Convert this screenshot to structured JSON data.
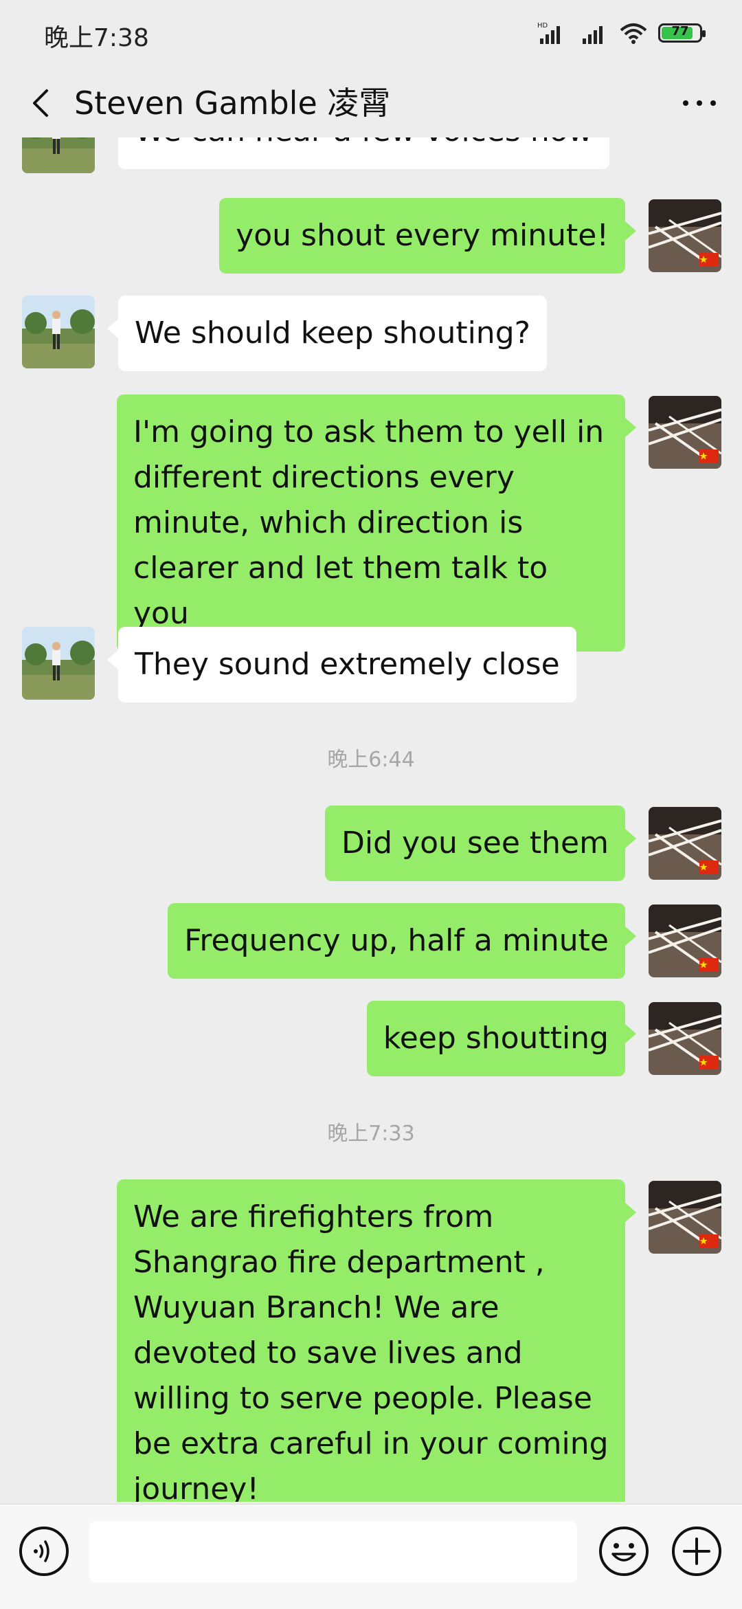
{
  "status_bar": {
    "time": "晚上7:38",
    "network_label": "HD",
    "battery_level": "77",
    "battery_fraction": 0.77
  },
  "header": {
    "title": "Steven Gamble 凌霄",
    "back_icon": "chevron-left-icon",
    "more_icon": "more-dots-icon"
  },
  "messages": [
    {
      "from": "other",
      "text": "We can hear a few voices now"
    },
    {
      "from": "me",
      "text": "you shout every minute!"
    },
    {
      "from": "other",
      "text": "We should keep shouting?"
    },
    {
      "from": "me",
      "text": "I'm going to ask them to yell in different directions every minute, which direction is clearer and let them talk to you"
    },
    {
      "from": "other",
      "text": "They sound extremely close"
    },
    {
      "timestamp": "晚上6:44"
    },
    {
      "from": "me",
      "text": "Did you see them"
    },
    {
      "from": "me",
      "text": "Frequency up, half a minute"
    },
    {
      "from": "me",
      "text": "keep shoutting"
    },
    {
      "timestamp": "晚上7:33"
    },
    {
      "from": "me",
      "text": "We are firefighters from Shangrao fire department , Wuyuan Branch! We are devoted to save lives and willing to serve people. Please be extra careful in your coming journey!"
    }
  ],
  "input_bar": {
    "voice_icon": "voice-icon",
    "emoji_icon": "emoji-icon",
    "plus_icon": "plus-icon",
    "input_value": ""
  },
  "colors": {
    "background": "#ededed",
    "my_bubble": "#95ec69",
    "other_bubble": "#ffffff",
    "timestamp": "#a6a6a6"
  }
}
